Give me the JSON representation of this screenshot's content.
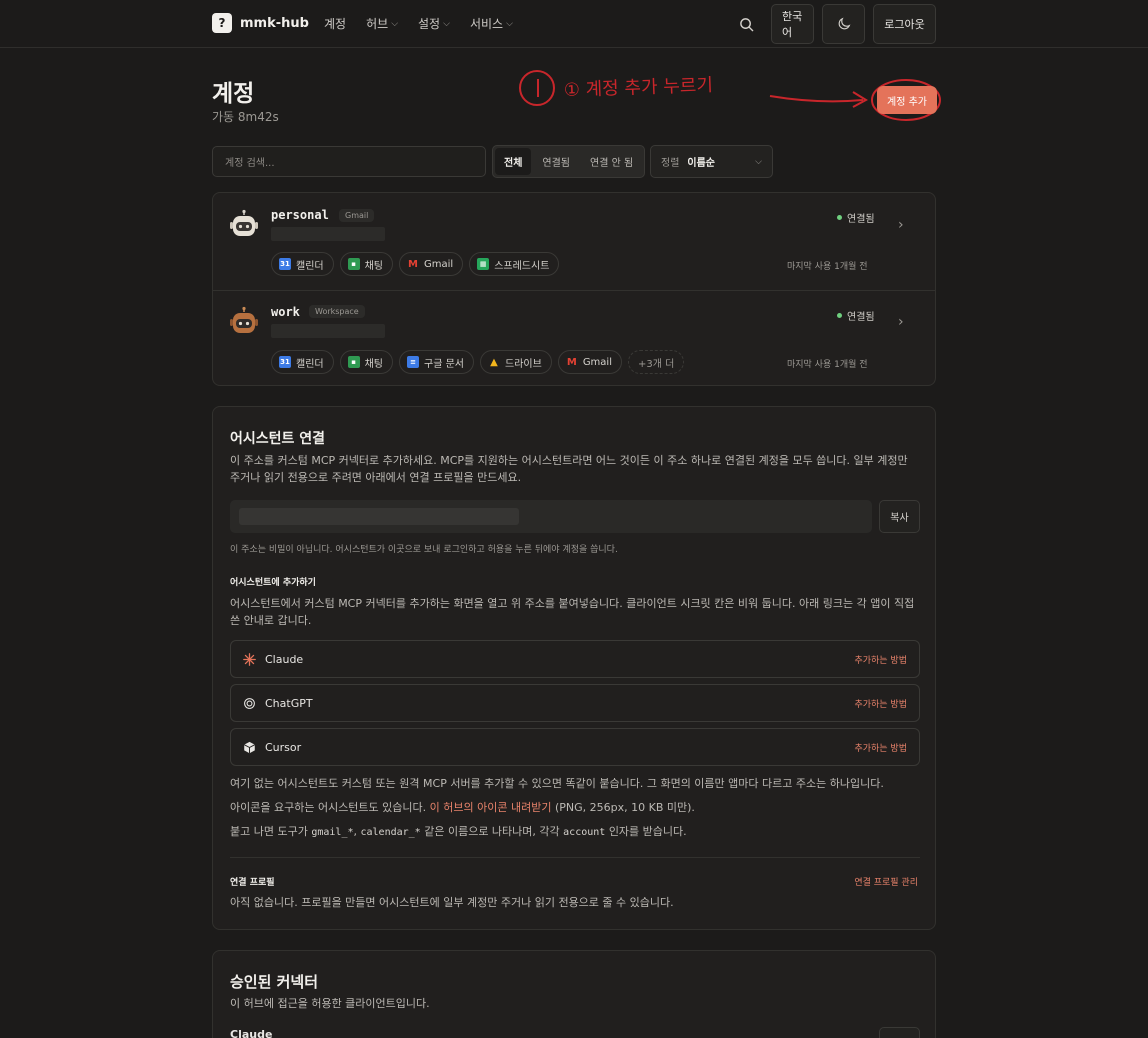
{
  "nav": {
    "brand": "mmk-hub",
    "items": [
      {
        "label": "계정",
        "dropdown": false
      },
      {
        "label": "허브",
        "dropdown": true
      },
      {
        "label": "설정",
        "dropdown": true
      },
      {
        "label": "서비스",
        "dropdown": true
      }
    ],
    "language": "한국어",
    "logout": "로그아웃"
  },
  "header": {
    "title": "계정",
    "uptime": "가동 8m42s",
    "add_button": "계정 추가",
    "annotation": "① 계정 추가 누르기"
  },
  "filters": {
    "search_placeholder": "계정 검색...",
    "segments": [
      "전체",
      "연결됨",
      "연결 안 됨"
    ],
    "active_segment": "전체",
    "sort_label": "정렬",
    "sort_value": "이름순"
  },
  "accounts": [
    {
      "name": "personal",
      "tag": "Gmail",
      "status": "연결됨",
      "services": [
        {
          "icon": "calendar-icon",
          "label": "캘린더"
        },
        {
          "icon": "chat-icon",
          "label": "채팅"
        },
        {
          "icon": "gmail-icon",
          "label": "Gmail"
        },
        {
          "icon": "sheets-icon",
          "label": "스프레드시트"
        }
      ],
      "more": "",
      "last_used": "마지막 사용 1개월 전"
    },
    {
      "name": "work",
      "tag": "Workspace",
      "status": "연결됨",
      "services": [
        {
          "icon": "calendar-icon",
          "label": "캘린더"
        },
        {
          "icon": "chat-icon",
          "label": "채팅"
        },
        {
          "icon": "docs-icon",
          "label": "구글 문서"
        },
        {
          "icon": "drive-icon",
          "label": "드라이브"
        },
        {
          "icon": "gmail-icon",
          "label": "Gmail"
        }
      ],
      "more": "+3개 더",
      "last_used": "마지막 사용 1개월 전"
    }
  ],
  "assistant": {
    "title": "어시스턴트 연결",
    "desc": "이 주소를 커스텀 MCP 커넥터로 추가하세요. MCP를 지원하는 어시스턴트라면 어느 것이든 이 주소 하나로 연결된 계정을 모두 씁니다. 일부 계정만 주거나 읽기 전용으로 주려면 아래에서 연결 프로필을 만드세요.",
    "copy": "복사",
    "url_note": "이 주소는 비밀이 아닙니다. 어시스턴트가 이곳으로 보내 로그인하고 허용을 누른 뒤에야 계정을 씁니다.",
    "add_title": "어시스턴트에 추가하기",
    "add_desc": "어시스턴트에서 커스텀 MCP 커넥터를 추가하는 화면을 열고 위 주소를 붙여넣습니다. 클라이언트 시크릿 칸은 비워 둡니다. 아래 링크는 각 앱이 직접 쓴 안내로 갑니다.",
    "apps": [
      {
        "name": "Claude",
        "icon": "claude-icon",
        "link": "추가하는 방법"
      },
      {
        "name": "ChatGPT",
        "icon": "chatgpt-icon",
        "link": "추가하는 방법"
      },
      {
        "name": "Cursor",
        "icon": "cursor-icon",
        "link": "추가하는 방법"
      }
    ],
    "other_note": "여기 없는 어시스턴트도 커스텀 또는 원격 MCP 서버를 추가할 수 있으면 똑같이 붙습니다. 그 화면의 이름만 앱마다 다르고 주소는 하나입니다.",
    "icon_note_pre": "아이콘을 요구하는 어시스턴트도 있습니다.",
    "icon_link": "이 허브의 아이콘 내려받기",
    "icon_note_post": "(PNG, 256px, 10 KB 미만).",
    "tools_pre": "붙고 나면 도구가",
    "tools_code1": "gmail_*",
    "tools_sep": ",",
    "tools_code2": "calendar_*",
    "tools_mid": "같은 이름으로 나타나며, 각각",
    "tools_code3": "account",
    "tools_post": "인자를 받습니다.",
    "profile_title": "연결 프로필",
    "profile_manage": "연결 프로필 관리",
    "profile_desc": "아직 없습니다. 프로필을 만들면 어시스턴트에 일부 계정만 주거나 읽기 전용으로 줄 수 있습니다."
  },
  "approved": {
    "title": "승인된 커넥터",
    "desc": "이 허브에 접근을 허용한 클라이언트입니다.",
    "first_client": "Claude"
  },
  "colors": {
    "background": "#1c1b1a",
    "accent": "#e4735a",
    "link": "#e8836b",
    "connected": "#6fcf7f",
    "annotation": "#c8262b"
  }
}
